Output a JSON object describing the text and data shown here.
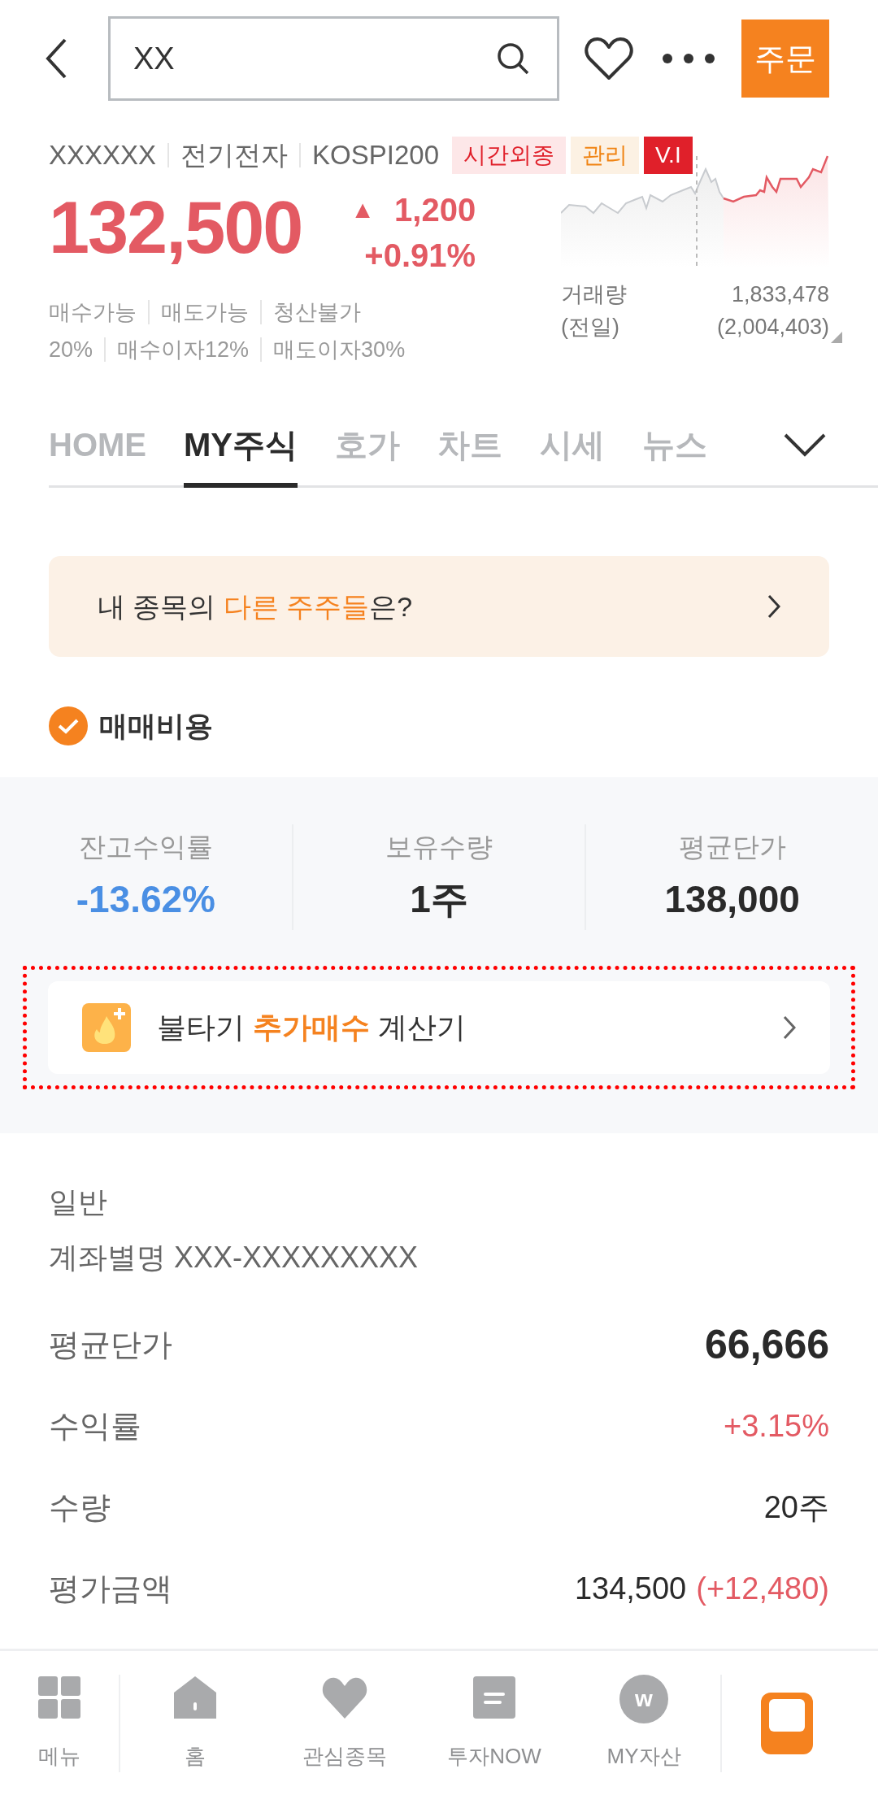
{
  "header": {
    "search_value": "XX",
    "order_button": "주문"
  },
  "stock": {
    "code": "XXXXXX",
    "name": "전기전자",
    "index": "KOSPI200",
    "tags": [
      {
        "label": "시간외종",
        "kind": "alert"
      },
      {
        "label": "관리",
        "kind": "warning"
      },
      {
        "label": "V.I",
        "kind": "solid"
      }
    ],
    "price": "132,500",
    "change_arrow": "▲",
    "change": "1,200",
    "change_rate": "+0.91%",
    "conditions": [
      [
        "매수가능",
        "매도가능",
        "청산불가"
      ],
      [
        "20%",
        "매수이자12%",
        "매도이자30%"
      ]
    ],
    "volume_label": "거래량",
    "volume": "1,833,478",
    "prev_label": "(전일)",
    "prev_volume": "(2,004,403)"
  },
  "tabs": [
    {
      "label": "HOME",
      "selected": false
    },
    {
      "label": "MY주식",
      "selected": true
    },
    {
      "label": "호가",
      "selected": false
    },
    {
      "label": "차트",
      "selected": false
    },
    {
      "label": "시세",
      "selected": false
    },
    {
      "label": "뉴스",
      "selected": false
    }
  ],
  "banner": {
    "text": "내 종목의 **다른 주주들**은?"
  },
  "fee_option": {
    "label": "매매비용",
    "checked": true
  },
  "stats": [
    {
      "label": "잔고수익률",
      "value": "-13.62%",
      "kind": "down"
    },
    {
      "label": "보유수량",
      "value": "1주",
      "kind": "plain"
    },
    {
      "label": "평균단가",
      "value": "138,000",
      "kind": "plain"
    }
  ],
  "calculator": {
    "text": "불타기 **추가매수** 계산기"
  },
  "account": {
    "type": "일반",
    "alias": "계좌별명 XXX-XXXXXXXXX"
  },
  "details": [
    {
      "label": "평균단가",
      "value": "66,666",
      "kind": "strong"
    },
    {
      "label": "수익률",
      "value": "+3.15%",
      "kind": "up"
    },
    {
      "label": "수량",
      "value": "20주",
      "kind": "plain"
    },
    {
      "label": "평가금액",
      "value": "134,500",
      "extra": "(+12,480)",
      "kind": "plain"
    }
  ],
  "nav": [
    {
      "label": "메뉴",
      "kind": "grid"
    },
    {
      "label": "홈",
      "kind": "home"
    },
    {
      "label": "관심종목",
      "kind": "heart"
    },
    {
      "label": "투자NOW",
      "kind": "doc"
    },
    {
      "label": "MY자산",
      "kind": "coin",
      "icon_letter": "w"
    }
  ]
}
